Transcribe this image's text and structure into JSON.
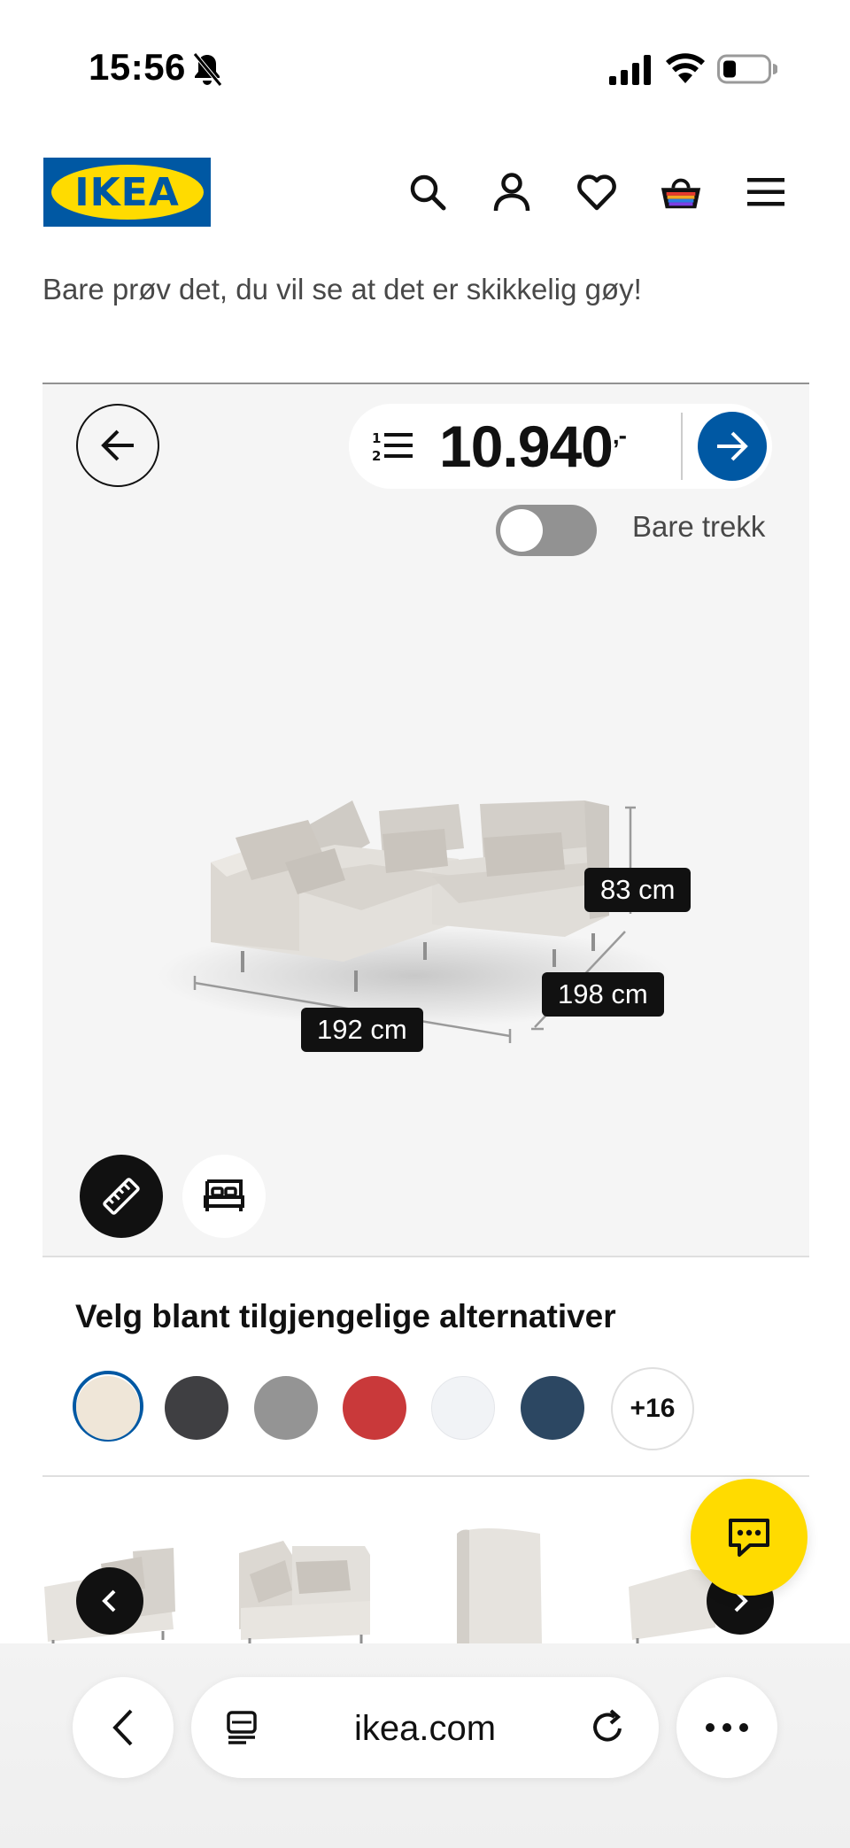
{
  "status_bar": {
    "time": "15:56"
  },
  "header": {
    "logo_text": "IKEA",
    "icons": [
      "search-icon",
      "account-icon",
      "heart-icon",
      "basket-icon",
      "menu-icon"
    ]
  },
  "tagline": "Bare prøv det, du vil se at det er skikkelig gøy!",
  "configurator": {
    "price_main": "10.940",
    "price_suffix": ",-",
    "toggle_label": "Bare trekk",
    "toggle_on": false,
    "dimensions": {
      "height": "83 cm",
      "depth": "198 cm",
      "width": "192 cm"
    }
  },
  "options": {
    "title": "Velg blant tilgjengelige alternativer",
    "colors": [
      "#efe6d8",
      "#3f3f42",
      "#949494",
      "#c9393a",
      "#f1f3f6",
      "#2c4762"
    ],
    "selected_index": 0,
    "more_label": "+16"
  },
  "carousel": {
    "items": [
      "chaise-longue-module",
      "corner-module",
      "armrest-module",
      "chaise-longue-module"
    ]
  },
  "browser": {
    "url": "ikea.com"
  },
  "colors": {
    "ikea_blue": "#0058a3",
    "ikea_yellow": "#ffdb00"
  }
}
